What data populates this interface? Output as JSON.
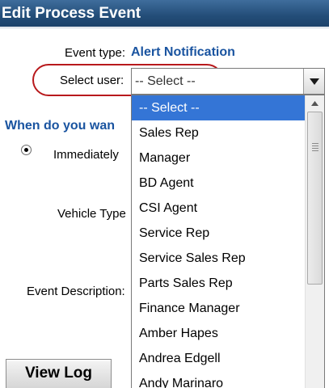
{
  "window": {
    "title": "Edit Process Event"
  },
  "form": {
    "event_type_label": "Event type:",
    "event_type_value": "Alert Notification",
    "select_user_label": "Select user:",
    "select_user_value": "-- Select --",
    "section_heading": "When do you wan",
    "immediately_label": "Immediately",
    "vehicle_type_label": "Vehicle Type",
    "event_description_label": "Event Description:"
  },
  "dropdown": {
    "options": [
      "-- Select --",
      "Sales Rep",
      "Manager",
      "BD Agent",
      "CSI Agent",
      "Service Rep",
      "Service Sales Rep",
      "Parts Sales Rep",
      "Finance Manager",
      "Amber Hapes",
      "Andrea Edgell",
      "Andy Marinaro"
    ],
    "selected_index": 0
  },
  "buttons": {
    "view_log": "View Log"
  },
  "colors": {
    "title_bar": "#234d78",
    "accent_blue": "#1a54a0",
    "selected_option": "#3475d6",
    "highlight_ring": "#b8191c"
  }
}
